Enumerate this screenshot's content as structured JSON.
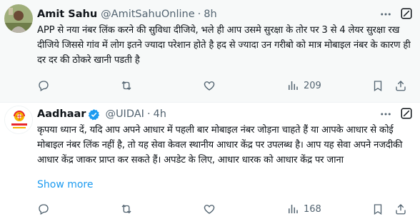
{
  "tweets": [
    {
      "author_name": "Amit Sahu",
      "handle": "@AmitSahuOnline",
      "separator": "·",
      "time": "8h",
      "text": "APP से नया नंबर लिंक करने की सुविधा दीजिये, भले ही आप उसमे सुरक्षा के तोर पर 3 से 4 लेयर सुरक्षा रख दीजिये जिससे गांव में लोग इतने ज्यादा परेशान होते है हद से ज्यादा उन गरीबो को मात्र मोबाइल नंबर के कारण ही दर दर की ठोकरे खानी पडती है",
      "views": "209",
      "avatar_icon": "user-photo-avatar",
      "background": "#f7f9f9"
    },
    {
      "author_name": "Aadhaar",
      "handle": "@UIDAI",
      "separator": "·",
      "time": "4h",
      "text": "कृपया ध्यान दें, यदि आप अपने आधार में पहली बार मोबाइल नंबर जोड़ना चाहते हैं या आपके आधार से कोई मोबाइल नंबर लिंक नहीं है, तो यह सेवा केवल स्थानीय आधार केंद्र पर उपलब्ध है। आप यह सेवा अपने नजदीकी आधार केंद्र जाकर प्राप्त कर सकते हैं। अपडेट के लिए, आधार धारक को आधार केंद्र पर जाना",
      "show_more": "Show more",
      "views": "168",
      "avatar_icon": "aadhaar-logo",
      "verified": true,
      "background": "#ffffff"
    }
  ],
  "colors": {
    "text": "#0f1419",
    "muted": "#536471",
    "link": "#1d9bf0",
    "verified": "#1d9bf0",
    "aadhaar_red": "#e8262b",
    "aadhaar_yellow": "#f5b400"
  }
}
